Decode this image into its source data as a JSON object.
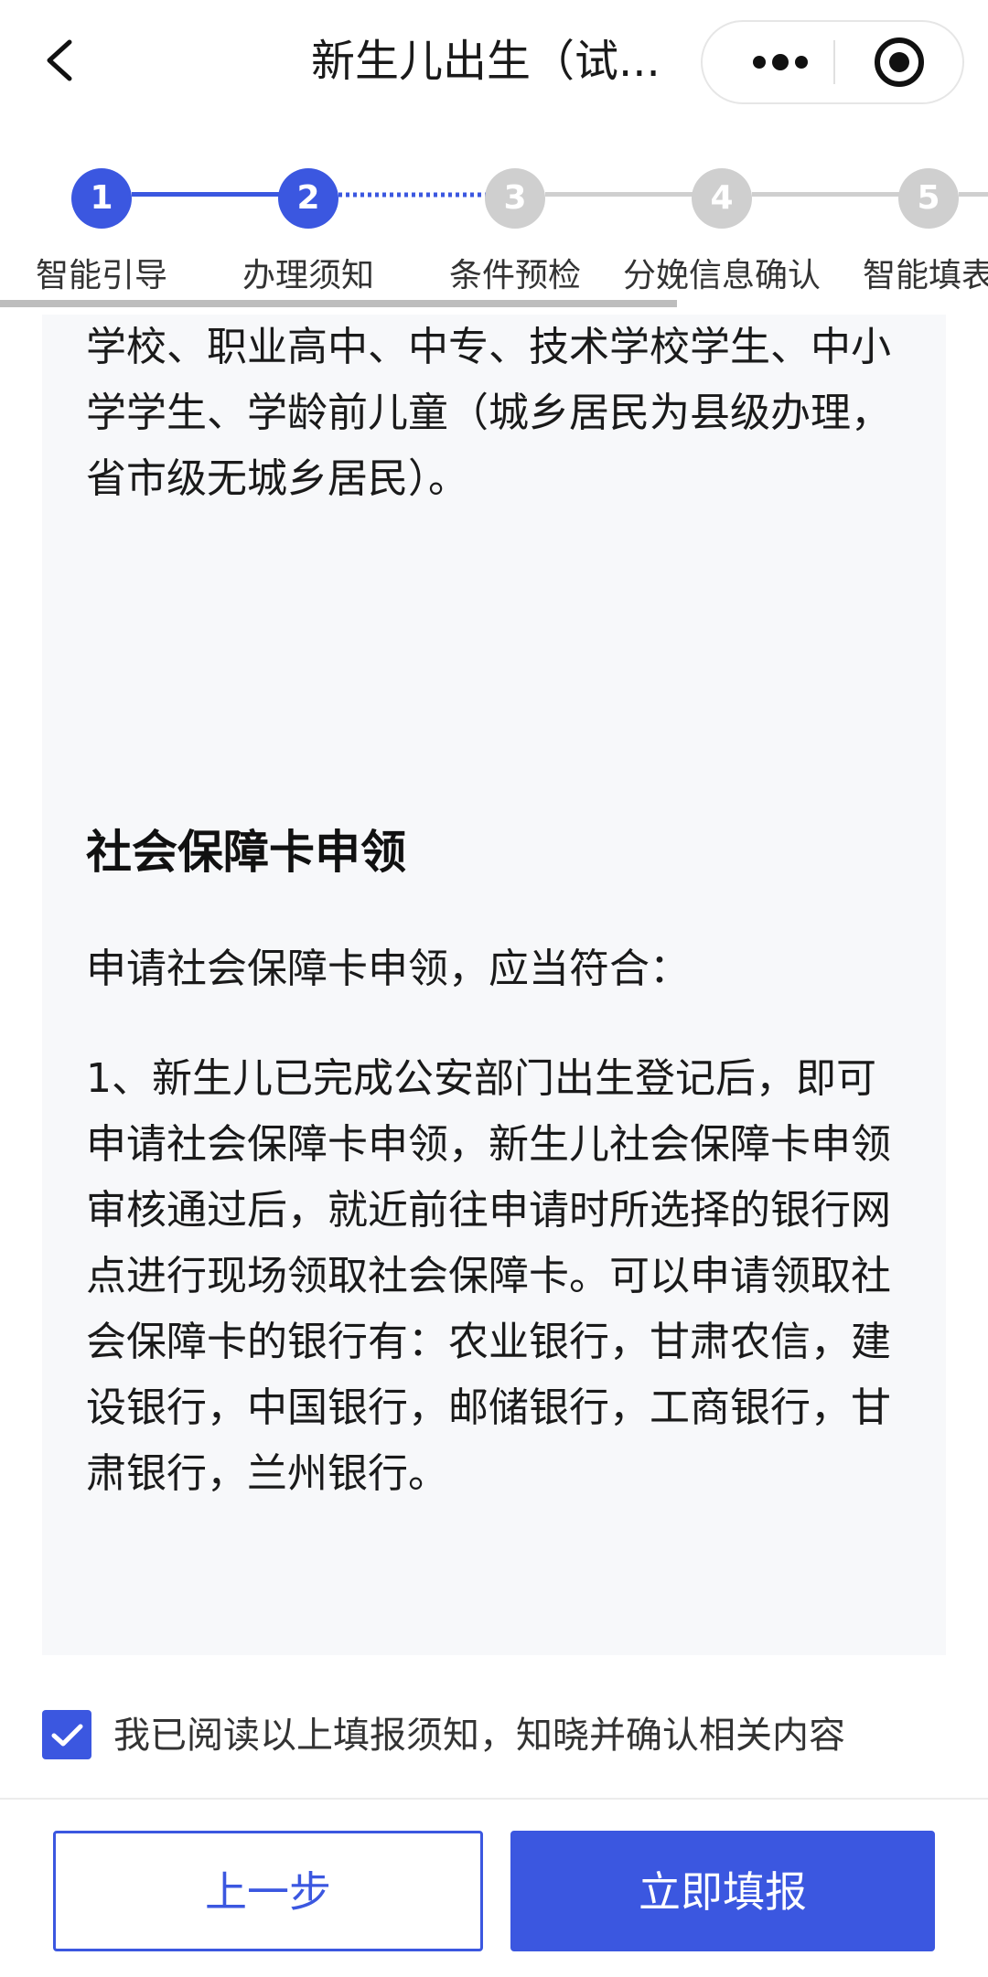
{
  "header": {
    "title": "新生儿出生（试..."
  },
  "steps": [
    {
      "number": "1",
      "label": "智能引导",
      "status": "done"
    },
    {
      "number": "2",
      "label": "办理须知",
      "status": "current"
    },
    {
      "number": "3",
      "label": "条件预检",
      "status": "pending"
    },
    {
      "number": "4",
      "label": "分娩信息确认",
      "status": "pending"
    },
    {
      "number": "5",
      "label": "智能填表",
      "status": "pending"
    }
  ],
  "content": {
    "intro_paragraph": "学校、职业高中、中专、技术学校学生、中小学学生、学龄前儿童（城乡居民为县级办理，省市级无城乡居民）。",
    "section_title": "社会保障卡申领",
    "section_lead": "申请社会保障卡申领，应当符合：",
    "section_item_1": "1、新生儿已完成公安部门出生登记后，即可申请社会保障卡申领，新生儿社会保障卡申领审核通过后，就近前往申请时所选择的银行网点进行现场领取社会保障卡。可以申请领取社会保障卡的银行有：农业银行，甘肃农信，建设银行，中国银行，邮储银行，工商银行，甘肃银行，兰州银行。"
  },
  "agreement": {
    "checked": true,
    "text": "我已阅读以上填报须知，知晓并确认相关内容"
  },
  "buttons": {
    "prev_label": "上一步",
    "submit_label": "立即填报"
  },
  "colors": {
    "accent": "#3b57e0",
    "inactive_step": "#cfcfcf",
    "card_background": "#f7f8fa"
  }
}
